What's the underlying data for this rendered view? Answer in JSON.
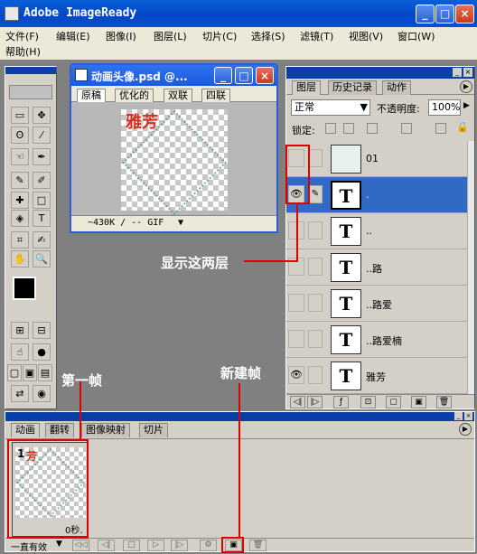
{
  "app": {
    "title": "Adobe ImageReady",
    "window_buttons": [
      "_",
      "□",
      "×"
    ]
  },
  "menu": [
    "文件(F)",
    "编辑(E)",
    "图像(I)",
    "图层(L)",
    "切片(C)",
    "选择(S)",
    "滤镜(T)",
    "视图(V)",
    "窗口(W)",
    "帮助(H)"
  ],
  "toolbox": {
    "tools": [
      "▭",
      "✥",
      "ʘ",
      "⁄",
      "☜",
      "✒",
      "✎",
      "✐",
      "✚",
      "□",
      "◈",
      "T",
      "⌗",
      "✍",
      "✋",
      "🔍",
      "⊞",
      "⊟",
      "☝",
      "●",
      "▢",
      "▣",
      "▤",
      "⇄",
      "◉"
    ]
  },
  "document": {
    "title": "动画头像.psd @...",
    "tabs": [
      "原稿",
      "优化的",
      "双联",
      "四联"
    ],
    "canvas_text": "雅芳",
    "status": "~430K / -- GIF"
  },
  "layers": {
    "tabs": [
      "图层",
      "历史记录",
      "动作"
    ],
    "blend_mode": "正常",
    "opacity_label": "不透明度:",
    "opacity": "100%",
    "lock_label": "锁定:",
    "rows": [
      {
        "name": "01",
        "thumb": "",
        "eye": "",
        "link": "",
        "selected": false
      },
      {
        "name": ".",
        "thumb": "T",
        "eye": "👁",
        "link": "✎",
        "selected": true
      },
      {
        "name": "..",
        "thumb": "T",
        "eye": "",
        "link": "",
        "selected": false
      },
      {
        "name": "..路",
        "thumb": "T",
        "eye": "",
        "link": "",
        "selected": false
      },
      {
        "name": "..路爱",
        "thumb": "T",
        "eye": "",
        "link": "",
        "selected": false
      },
      {
        "name": "..路爱楠",
        "thumb": "T",
        "eye": "",
        "link": "",
        "selected": false
      },
      {
        "name": "雅芳",
        "thumb": "T",
        "eye": "👁",
        "link": "",
        "selected": false
      }
    ],
    "footer_buttons": [
      "◁|",
      "|▷",
      "ƒ",
      "⊡",
      "▢",
      "▣",
      "🗑"
    ]
  },
  "animation": {
    "tabs": [
      "动画",
      "翻转",
      "图像映射",
      "切片"
    ],
    "frame": {
      "number": "1",
      "delay": "0秒.",
      "text": "芳"
    },
    "loop": "一直有效",
    "controls": [
      "◁◁",
      "◁|",
      "□",
      "▷",
      "|▷",
      "⚙",
      "▣",
      "🗑"
    ]
  },
  "annotations": {
    "show_layers": "显示这两层",
    "first_frame": "第一帧",
    "new_frame": "新建帧"
  },
  "colors": {
    "highlight": "#e00000",
    "selection": "#316ac5",
    "titlebar": "#0a5fd8"
  }
}
